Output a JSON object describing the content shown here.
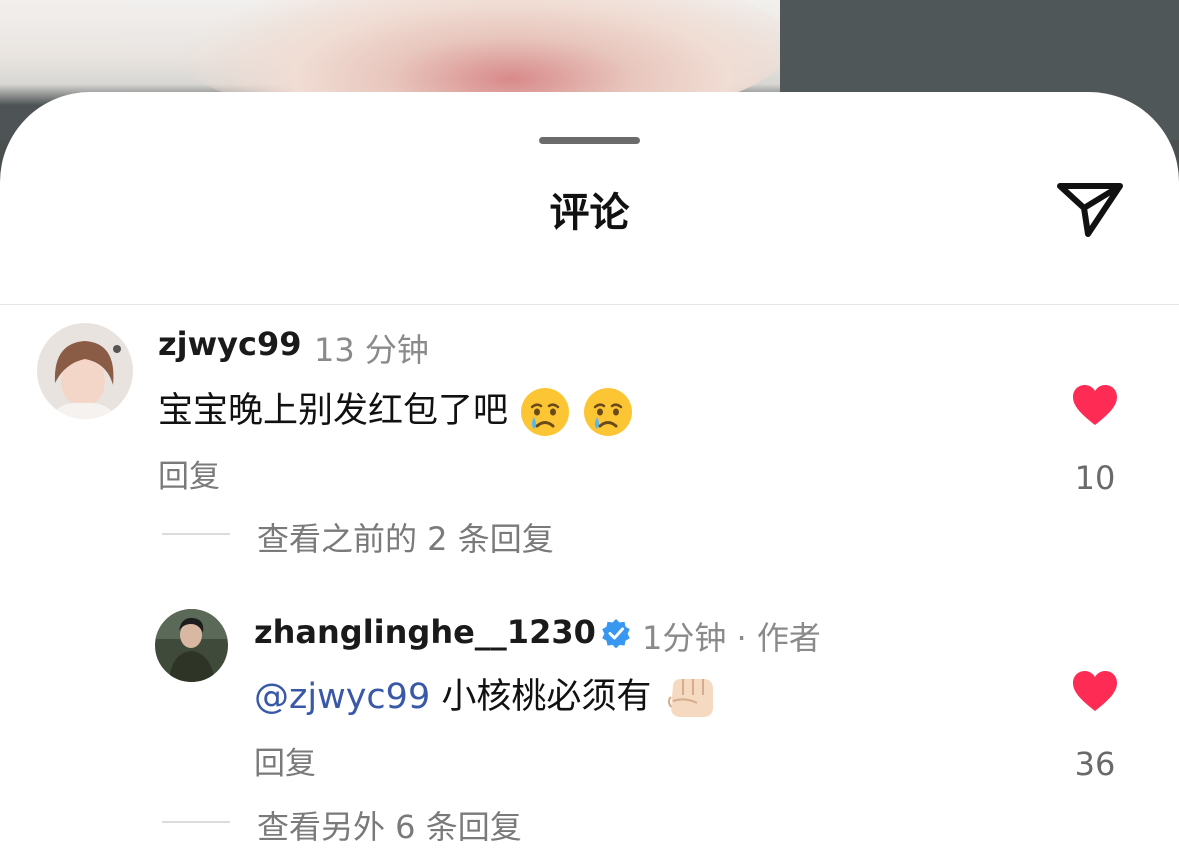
{
  "sheet": {
    "title": "评论",
    "share_icon": "send-icon"
  },
  "comments": [
    {
      "username": "zjwyc99",
      "time": "13 分钟",
      "text": "宝宝晚上别发红包了吧",
      "emojis": [
        "crying-face-emoji",
        "crying-face-emoji"
      ],
      "reply_label": "回复",
      "likes": "10",
      "more_replies": "查看之前的 2 条回复"
    },
    {
      "username": "zhanglinghe__1230",
      "verified": true,
      "time": "1分钟 · 作者",
      "mention": "@zjwyc99",
      "text": "小核桃必须有",
      "emojis": [
        "fist-bump-emoji"
      ],
      "reply_label": "回复",
      "likes": "36",
      "more_replies": "查看另外 6 条回复"
    }
  ],
  "colors": {
    "like": "#fe2c55",
    "mention": "#3a58a8",
    "verified": "#3897f0"
  }
}
